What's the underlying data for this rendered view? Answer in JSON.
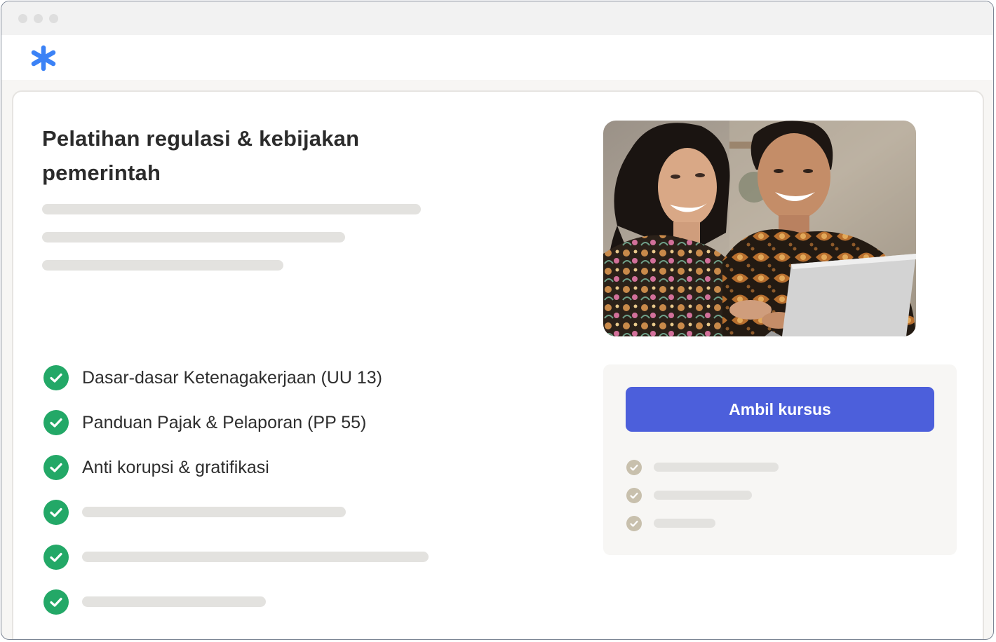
{
  "window": {
    "controls": [
      "close",
      "minimize",
      "maximize"
    ]
  },
  "header": {
    "logo_icon": "asterisk-icon",
    "logo_color": "#3b82f6"
  },
  "course": {
    "title": "Pelatihan regulasi & kebijakan pemerintah",
    "features": [
      {
        "label": "Dasar-dasar Ketenagakerjaan (UU 13)"
      },
      {
        "label": "Panduan Pajak & Pelaporan (PP 55)"
      },
      {
        "label": "Anti korupsi & gratifikasi"
      },
      {
        "label": ""
      },
      {
        "label": ""
      },
      {
        "label": ""
      }
    ],
    "check_color": "#23a867"
  },
  "sidebar": {
    "cta_label": "Ambil kursus",
    "cta_color": "#4c5fdb"
  }
}
